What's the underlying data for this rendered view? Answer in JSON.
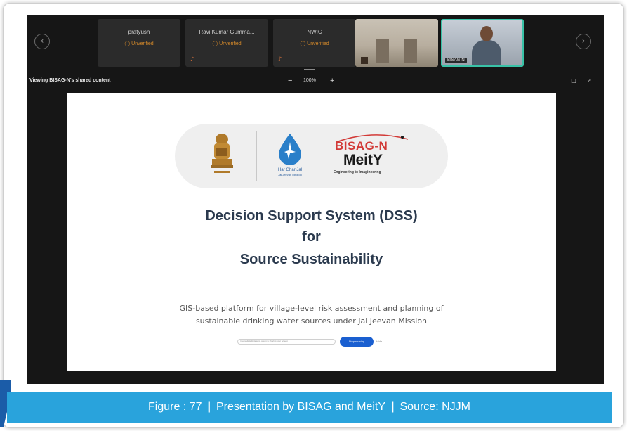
{
  "participants": [
    {
      "name": "pratyush",
      "status": "Unverified"
    },
    {
      "name": "Ravi Kumar Gumma...",
      "status": "Unverified"
    },
    {
      "name": "NWIC",
      "status": "Unverified"
    }
  ],
  "camera_tiles": [
    {
      "label": ""
    },
    {
      "label": "BISAG-N"
    }
  ],
  "view_bar": {
    "viewing_text": "Viewing BISAG-N's shared content",
    "zoom_out": "−",
    "zoom_level": "100%",
    "zoom_in": "+"
  },
  "slide": {
    "logo_drop_caption_1": "Har Ghar Jal",
    "logo_drop_caption_2": "Jal Jeevan Mission",
    "logo_bisag": "BISAG-N",
    "logo_meity": "MeitY",
    "logo_tagline": "Engineering to Imagineering",
    "title_line1": "Decision Support System (DSS)",
    "title_line2": "for",
    "title_line3": "Source Sustainability",
    "desc_line1": "GIS-based platform for village-level risk assessment and planning of",
    "desc_line2": "sustainable drinking water sources under Jal Jeevan Mission",
    "share_notice": "rnuanadjaladrnissions.gov.in is sharing your screen",
    "share_button": "Stop sharing",
    "share_hide": "Hide"
  },
  "caption": {
    "figure": "Figure : 77",
    "sep": "|",
    "title": "Presentation by BISAG and MeitY",
    "source": "Source: NJJM"
  },
  "colors": {
    "caption_bg": "#29a3dc",
    "accent_blue": "#1b5ca8",
    "meeting_bg": "#161616",
    "unverified": "#d68a2a",
    "active_speaker": "#39c2a7",
    "bisag_red": "#d23a37"
  },
  "icons": {
    "prev": "chevron-left-icon",
    "next": "chevron-right-icon",
    "mic_off": "mic-off-icon",
    "shield": "shield-icon",
    "chat": "chat-icon",
    "expand": "expand-icon"
  }
}
